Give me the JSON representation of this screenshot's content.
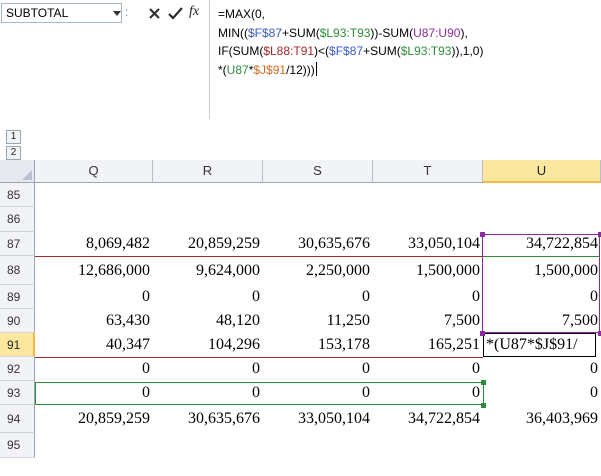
{
  "formula_bar": {
    "name_box": "SUBTOTAL",
    "separator": ":",
    "fx_label": "fx",
    "formula_lines": [
      [
        {
          "t": "=MAX(0,",
          "c": "#000000"
        }
      ],
      [
        {
          "t": "MIN((",
          "c": "#000000"
        },
        {
          "t": "$F$87",
          "c": "#3a58c7"
        },
        {
          "t": "+SUM(",
          "c": "#000000"
        },
        {
          "t": "$L93:T93",
          "c": "#2e8b3c"
        },
        {
          "t": "))-SUM(",
          "c": "#000000"
        },
        {
          "t": "U87:U90",
          "c": "#8b2b9c"
        },
        {
          "t": "),",
          "c": "#000000"
        }
      ],
      [
        {
          "t": "IF(SUM(",
          "c": "#000000"
        },
        {
          "t": "$L88:T91",
          "c": "#a32828"
        },
        {
          "t": ")<(",
          "c": "#000000"
        },
        {
          "t": "$F$87",
          "c": "#3a58c7"
        },
        {
          "t": "+SUM(",
          "c": "#000000"
        },
        {
          "t": "$L93:T93",
          "c": "#2e8b3c"
        },
        {
          "t": ")),1,0)",
          "c": "#000000"
        }
      ],
      [
        {
          "t": "*(",
          "c": "#000000"
        },
        {
          "t": "U87",
          "c": "#2e8b3c"
        },
        {
          "t": "*",
          "c": "#000000"
        },
        {
          "t": "$J$91",
          "c": "#d2691e"
        },
        {
          "t": "/12)))",
          "c": "#000000"
        }
      ]
    ]
  },
  "outline": {
    "levels": [
      "1",
      "2"
    ]
  },
  "columns": [
    "Q",
    "R",
    "S",
    "T",
    "U"
  ],
  "selected_column": "U",
  "selected_row": "91",
  "rows": [
    {
      "row": "85",
      "cells": [
        "",
        "",
        "",
        "",
        ""
      ]
    },
    {
      "row": "86",
      "cells": [
        "",
        "",
        "",
        "",
        ""
      ]
    },
    {
      "row": "87",
      "cells": [
        "8,069,482",
        "20,859,259",
        "30,635,676",
        "33,050,104",
        "34,722,854"
      ]
    },
    {
      "row": "88",
      "cells": [
        "12,686,000",
        "9,624,000",
        "2,250,000",
        "1,500,000",
        "1,500,000"
      ]
    },
    {
      "row": "89",
      "cells": [
        "0",
        "0",
        "0",
        "0",
        "0"
      ]
    },
    {
      "row": "90",
      "cells": [
        "63,430",
        "48,120",
        "11,250",
        "7,500",
        "7,500"
      ]
    },
    {
      "row": "91",
      "cells": [
        "40,347",
        "104,296",
        "153,178",
        "165,251",
        "*(U87*$J$91/"
      ]
    },
    {
      "row": "92",
      "cells": [
        "0",
        "0",
        "0",
        "0",
        "0"
      ]
    },
    {
      "row": "93",
      "cells": [
        "0",
        "0",
        "0",
        "0",
        "0"
      ]
    },
    {
      "row": "94",
      "cells": [
        "20,859,259",
        "30,635,676",
        "33,050,104",
        "34,722,854",
        "36,403,969"
      ]
    },
    {
      "row": "95",
      "cells": [
        "",
        "",
        "",
        "",
        ""
      ]
    }
  ],
  "reference_colors": {
    "F87": "#3a58c7",
    "L93_T93": "#2e8b3c",
    "U87_U90": "#8b2b9c",
    "L88_T91": "#a32828",
    "U87": "#2e8b3c",
    "J91": "#d2691e"
  },
  "icons": {
    "cancel": "close-icon",
    "enter": "checkmark-icon",
    "function": "fx-icon",
    "name_box_dropdown": "chevron-down-icon",
    "select_all": "select-all-triangle-icon"
  }
}
